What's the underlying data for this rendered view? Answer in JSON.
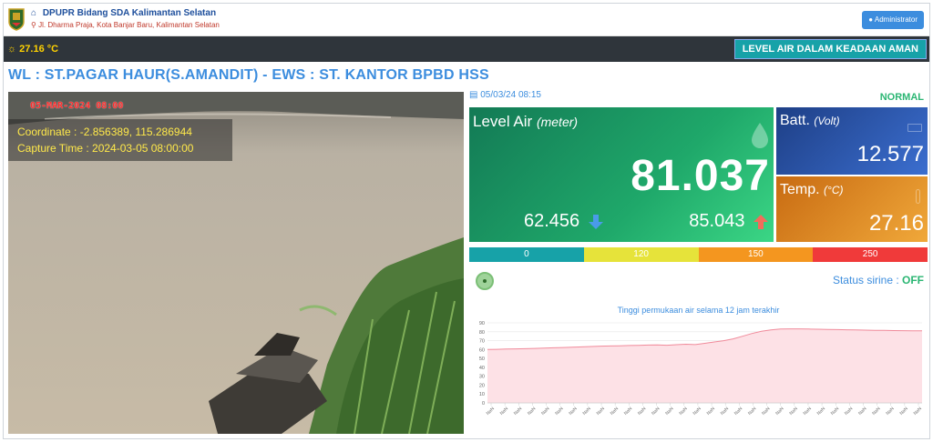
{
  "header": {
    "org_title": "DPUPR Bidang SDA Kalimantan Selatan",
    "org_address": "Jl. Dharma Praja, Kota Banjar Baru, Kalimantan Selatan",
    "admin_label": "Administrator"
  },
  "statusbar": {
    "temperature": "27.16 °C",
    "water_status": "LEVEL AIR DALAM KEADAAN AMAN"
  },
  "station": {
    "title": "WL : ST.PAGAR HAUR(S.AMANDIT) - EWS : ST. KANTOR BPBD HSS"
  },
  "camera": {
    "date_stamp": "05-MAR-2024 08:00",
    "coordinate": "Coordinate : -2.856389, 115.286944",
    "capture_time": "Capture Time : 2024-03-05 08:00:00"
  },
  "reading": {
    "timestamp": "05/03/24 08:15",
    "status": "NORMAL",
    "level_label": "Level Air",
    "level_unit": "(meter)",
    "level_value": "81.037",
    "level_min": "62.456",
    "level_max": "85.043",
    "batt_label": "Batt.",
    "batt_unit": "(Volt)",
    "batt_value": "12.577",
    "temp_label": "Temp.",
    "temp_unit": "(°C)",
    "temp_value": "27.16"
  },
  "thresholds": [
    {
      "label": "0",
      "color": "#17a2a8"
    },
    {
      "label": "120",
      "color": "#e6e33a"
    },
    {
      "label": "150",
      "color": "#f4961f"
    },
    {
      "label": "250",
      "color": "#f03a3a"
    }
  ],
  "siren": {
    "label": "Status sirine : ",
    "value": "OFF"
  },
  "chart_data": {
    "type": "area",
    "title": "Tinggi permukaan air selama 12 jam terakhir",
    "ylim": [
      0,
      90
    ],
    "yticks": [
      0,
      10,
      20,
      30,
      40,
      50,
      60,
      70,
      80,
      90
    ],
    "x_tick_label": "NaN",
    "x_tick_count": 32,
    "grid": true,
    "line_color": "#f08a9a",
    "fill_color": "#fde1e6",
    "series": [
      {
        "values": [
          60,
          60.2,
          60.5,
          60.8,
          61,
          61.3,
          61.6,
          62,
          62.3,
          62.6,
          63,
          63.4,
          63.8,
          64,
          64.2,
          64.5,
          64.7,
          65,
          65.2,
          64.8,
          65.5,
          66,
          65.6,
          67,
          68.5,
          70,
          72,
          75,
          78,
          80.5,
          82,
          83,
          83.3,
          83.2,
          83,
          82.8,
          82.6,
          82.4,
          82.2,
          82,
          81.8,
          81.6,
          81.5,
          81.3,
          81.2,
          81.1,
          81.04
        ]
      }
    ]
  }
}
